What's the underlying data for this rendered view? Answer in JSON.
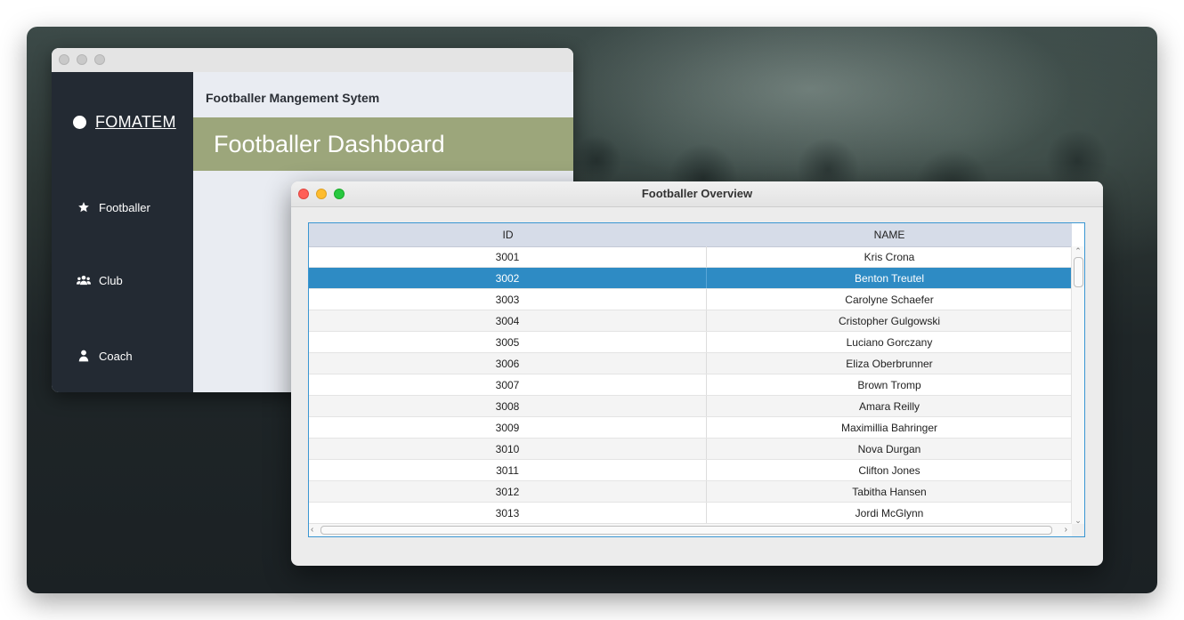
{
  "back_window": {
    "brand": "FOMATEM",
    "nav": [
      {
        "label": "Footballer",
        "icon": "star-icon"
      },
      {
        "label": "Club",
        "icon": "users-icon"
      },
      {
        "label": "Coach",
        "icon": "user-icon"
      }
    ],
    "app_heading": "Footballer Mangement Sytem",
    "banner_title": "Footballer Dashboard",
    "banner_color": "#9ca67b",
    "sidebar_color": "#232a33"
  },
  "front_window": {
    "title": "Footballer Overview",
    "table": {
      "columns": [
        "ID",
        "NAME"
      ],
      "selected_row": 1,
      "selection_color": "#2e8bc4",
      "rows": [
        {
          "id": "3001",
          "name": "Kris Crona"
        },
        {
          "id": "3002",
          "name": "Benton Treutel"
        },
        {
          "id": "3003",
          "name": "Carolyne Schaefer"
        },
        {
          "id": "3004",
          "name": "Cristopher Gulgowski"
        },
        {
          "id": "3005",
          "name": "Luciano Gorczany"
        },
        {
          "id": "3006",
          "name": "Eliza Oberbrunner"
        },
        {
          "id": "3007",
          "name": "Brown Tromp"
        },
        {
          "id": "3008",
          "name": "Amara Reilly"
        },
        {
          "id": "3009",
          "name": "Maximillia Bahringer"
        },
        {
          "id": "3010",
          "name": "Nova Durgan"
        },
        {
          "id": "3011",
          "name": "Clifton Jones"
        },
        {
          "id": "3012",
          "name": "Tabitha Hansen"
        },
        {
          "id": "3013",
          "name": "Jordi McGlynn"
        }
      ]
    }
  }
}
